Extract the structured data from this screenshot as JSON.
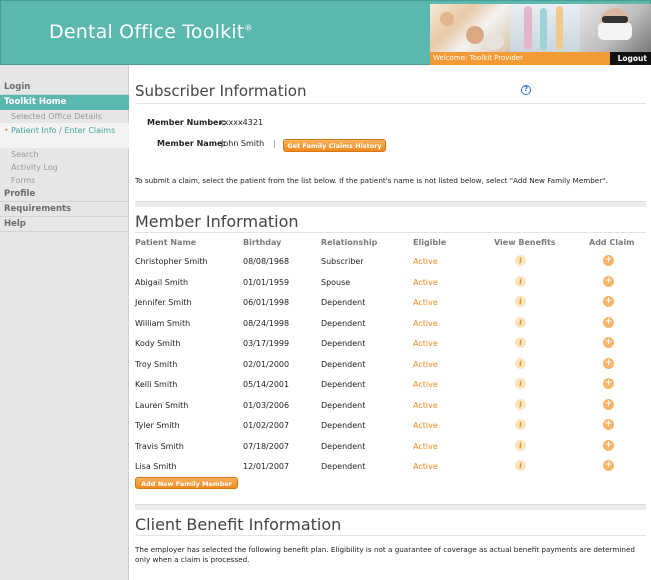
{
  "header": {
    "title": "Dental Office Toolkit",
    "trademark": "®",
    "welcome": "Welcome: Toolkit Provider",
    "logout_label": "Logout",
    "accent_color": "#5bb8ae",
    "orange_color": "#f29a35"
  },
  "sidebar": {
    "items": [
      {
        "label": "Login",
        "active": false
      },
      {
        "label": "Toolkit Home",
        "active": true
      },
      {
        "label": "Profile",
        "active": false
      },
      {
        "label": "Requirements",
        "active": false
      },
      {
        "label": "Help",
        "active": false
      }
    ],
    "subitems": [
      {
        "label": "Selected Office Details"
      },
      {
        "label": "Patient Info / Enter Claims",
        "current": true
      },
      {
        "label": "Search"
      },
      {
        "label": "Activity Log"
      },
      {
        "label": "Forms"
      }
    ]
  },
  "subscriber": {
    "title": "Subscriber Information",
    "help_icon": "question-circle-icon",
    "member_number_label": "Member Number:",
    "member_number": "xxxxx4321",
    "member_name_label": "Member Name:",
    "member_name": "John Smith",
    "separator": "|",
    "family_claims_button": "Get Family Claims History",
    "instruction": "To submit a claim, select the patient from the list below. If the patient's name is not listed below, select \"Add New Family Member\"."
  },
  "members": {
    "title": "Member Information",
    "columns": [
      "Patient Name",
      "Birthday",
      "Relationship",
      "Eligible",
      "View Benefits",
      "Add Claim"
    ],
    "rows": [
      {
        "name": "Christopher Smith",
        "birthday": "08/08/1968",
        "relationship": "Subscriber",
        "eligible": "Active"
      },
      {
        "name": "Abigail Smith",
        "birthday": "01/01/1959",
        "relationship": "Spouse",
        "eligible": "Active"
      },
      {
        "name": "Jennifer Smith",
        "birthday": "06/01/1998",
        "relationship": "Dependent",
        "eligible": "Active"
      },
      {
        "name": "William Smith",
        "birthday": "08/24/1998",
        "relationship": "Dependent",
        "eligible": "Active"
      },
      {
        "name": "Kody Smith",
        "birthday": "03/17/1999",
        "relationship": "Dependent",
        "eligible": "Active"
      },
      {
        "name": "Troy Smith",
        "birthday": "02/01/2000",
        "relationship": "Dependent",
        "eligible": "Active"
      },
      {
        "name": "Kelli Smith",
        "birthday": "05/14/2001",
        "relationship": "Dependent",
        "eligible": "Active"
      },
      {
        "name": "Lauren Smith",
        "birthday": "01/03/2006",
        "relationship": "Dependent",
        "eligible": "Active"
      },
      {
        "name": "Tyler Smith",
        "birthday": "01/02/2007",
        "relationship": "Dependent",
        "eligible": "Active"
      },
      {
        "name": "Travis Smith",
        "birthday": "07/18/2007",
        "relationship": "Dependent",
        "eligible": "Active"
      },
      {
        "name": "Lisa Smith",
        "birthday": "12/01/2007",
        "relationship": "Dependent",
        "eligible": "Active"
      }
    ],
    "view_icon": "info-icon",
    "add_icon": "plus-icon",
    "add_member_button": "Add New Family Member"
  },
  "client_benefit": {
    "title": "Client Benefit Information",
    "text": "The employer has selected the following benefit plan. Eligibility is not a guarantee of coverage as actual benefit payments are determined only when a claim is processed."
  }
}
